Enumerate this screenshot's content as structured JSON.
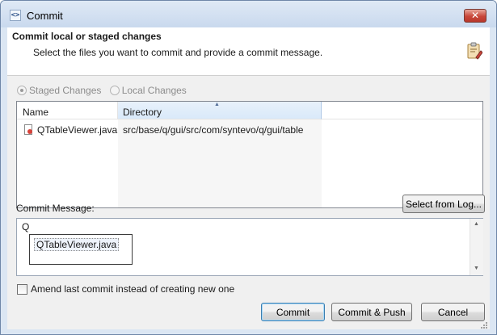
{
  "window": {
    "title": "Commit",
    "app_icon": "<>",
    "close_label": "✕"
  },
  "header": {
    "title": "Commit local or staged changes",
    "description": "Select the files you want to commit and provide a commit message.",
    "icon": "commit-clipboard-icon"
  },
  "source": {
    "options": [
      {
        "label": "Staged Changes",
        "selected": true
      },
      {
        "label": "Local Changes",
        "selected": false
      }
    ]
  },
  "files": {
    "columns": {
      "name": "Name",
      "directory": "Directory"
    },
    "sorted_by": "Directory",
    "rows": [
      {
        "name": "QTableViewer.java",
        "directory": "src/base/q/gui/src/com/syntevo/q/gui/table",
        "icon": "java-file-icon"
      }
    ]
  },
  "message": {
    "label": "Commit Message:",
    "value": "Q",
    "select_from_log_label": "Select from Log...",
    "suggestions": [
      "QTableViewer.java"
    ]
  },
  "amend": {
    "label": "Amend last commit instead of creating new one",
    "checked": false
  },
  "buttons": {
    "commit": "Commit",
    "commit_push": "Commit & Push",
    "cancel": "Cancel"
  }
}
